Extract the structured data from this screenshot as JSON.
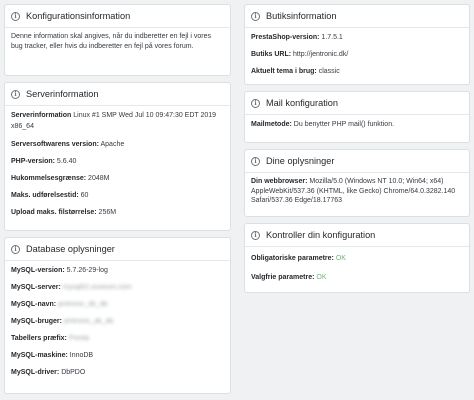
{
  "config_info": {
    "title": "Konfigurationsinformation",
    "text": "Denne information skal angives, når du indberetter en fejl i vores bug tracker, eller hvis du indberetter en fejl på vores forum."
  },
  "server_info": {
    "title": "Serverinformation",
    "rows": [
      {
        "label": "Serverinformation",
        "value": "Linux #1 SMP Wed Jul 10 09:47:30 EDT 2019 x86_64"
      },
      {
        "label": "Serversoftwarens version:",
        "value": "Apache"
      },
      {
        "label": "PHP-version:",
        "value": "5.6.40"
      },
      {
        "label": "Hukommelsesgrænse:",
        "value": "2048M"
      },
      {
        "label": "Maks. udførelsestid:",
        "value": "60"
      },
      {
        "label": "Upload maks. filstørrelse:",
        "value": "256M"
      }
    ]
  },
  "database_info": {
    "title": "Database oplysninger",
    "rows": [
      {
        "label": "MySQL-version:",
        "value": "5.7.26-29-log"
      },
      {
        "label": "MySQL-server:",
        "value": "mysql02.unoeuro.com"
      },
      {
        "label": "MySQL-navn:",
        "value": "jentronic_dk_db"
      },
      {
        "label": "MySQL-bruger:",
        "value": "jentronic_dk_db"
      },
      {
        "label": "Tabellers præfix:",
        "value": "Presta"
      },
      {
        "label": "MySQL-maskine:",
        "value": "InnoDB"
      },
      {
        "label": "MySQL-driver:",
        "value": "DbPDO"
      }
    ]
  },
  "shop_info": {
    "title": "Butiksinformation",
    "rows": [
      {
        "label": "PrestaShop-version:",
        "value": "1.7.5.1"
      },
      {
        "label": "Butiks URL:",
        "value": "http://jentronic.dk/"
      },
      {
        "label": "Aktuelt tema i brug:",
        "value": "classic"
      }
    ]
  },
  "mail_config": {
    "title": "Mail konfiguration",
    "rows": [
      {
        "label": "Mailmetode:",
        "value": "Du benytter PHP mail() funktion."
      }
    ]
  },
  "your_info": {
    "title": "Dine oplysninger",
    "rows": [
      {
        "label": "Din webbrowser:",
        "value": "Mozilla/5.0 (Windows NT 10.0; Win64; x64) AppleWebKit/537.36 (KHTML, like Gecko) Chrome/64.0.3282.140 Safari/537.36 Edge/18.17763"
      }
    ]
  },
  "check_config": {
    "title": "Kontroller din konfiguration",
    "rows": [
      {
        "label": "Obligatoriske parametre:",
        "value": "OK"
      },
      {
        "label": "Valgfrie parametre:",
        "value": "OK"
      }
    ]
  },
  "colors": {
    "ok": "#70b580",
    "background": "#eff1f2"
  },
  "icons": {
    "panel_header": "info-icon"
  }
}
